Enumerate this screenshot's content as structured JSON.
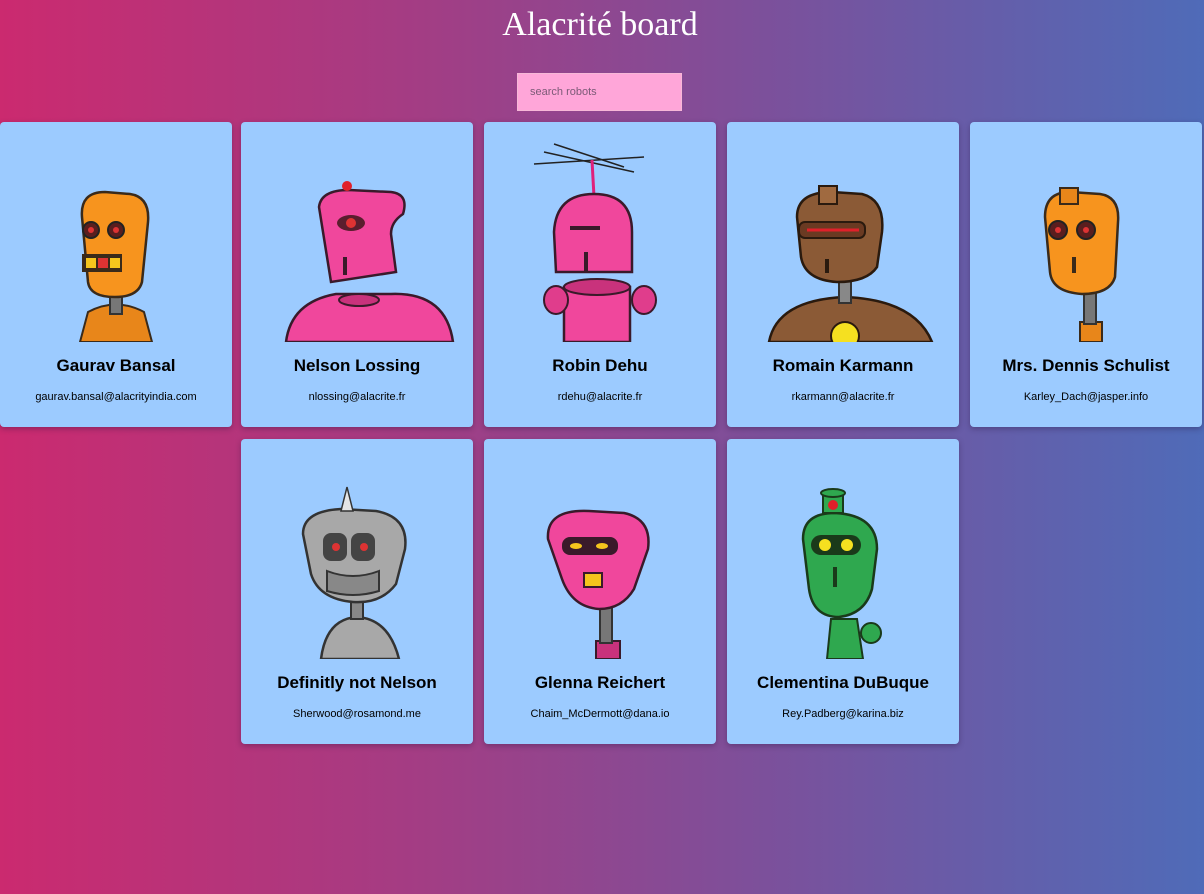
{
  "app": {
    "title": "Alacrité board"
  },
  "search": {
    "placeholder": "search robots",
    "value": ""
  },
  "robots": [
    {
      "name": "Gaurav Bansal",
      "email": "gaurav.bansal@alacrityindia.com",
      "color": "#f7941e",
      "icon": "orange-robot-avatar"
    },
    {
      "name": "Nelson Lossing",
      "email": "nlossing@alacrite.fr",
      "color": "#f0479c",
      "icon": "pink-robot-avatar"
    },
    {
      "name": "Robin Dehu",
      "email": "rdehu@alacrite.fr",
      "color": "#f0479c",
      "icon": "pink-antenna-robot-avatar"
    },
    {
      "name": "Romain Karmann",
      "email": "rkarmann@alacrite.fr",
      "color": "#8b5a36",
      "icon": "brown-robot-avatar"
    },
    {
      "name": "Mrs. Dennis Schulist",
      "email": "Karley_Dach@jasper.info",
      "color": "#f7941e",
      "icon": "orange-robot-avatar"
    },
    {
      "name": "Definitly not Nelson",
      "email": "Sherwood@rosamond.me",
      "color": "#a8a8a8",
      "icon": "gray-robot-avatar"
    },
    {
      "name": "Glenna Reichert",
      "email": "Chaim_McDermott@dana.io",
      "color": "#f0479c",
      "icon": "pink-robot-avatar"
    },
    {
      "name": "Clementina DuBuque",
      "email": "Rey.Padberg@karina.biz",
      "color": "#2fa84f",
      "icon": "green-robot-avatar"
    }
  ]
}
